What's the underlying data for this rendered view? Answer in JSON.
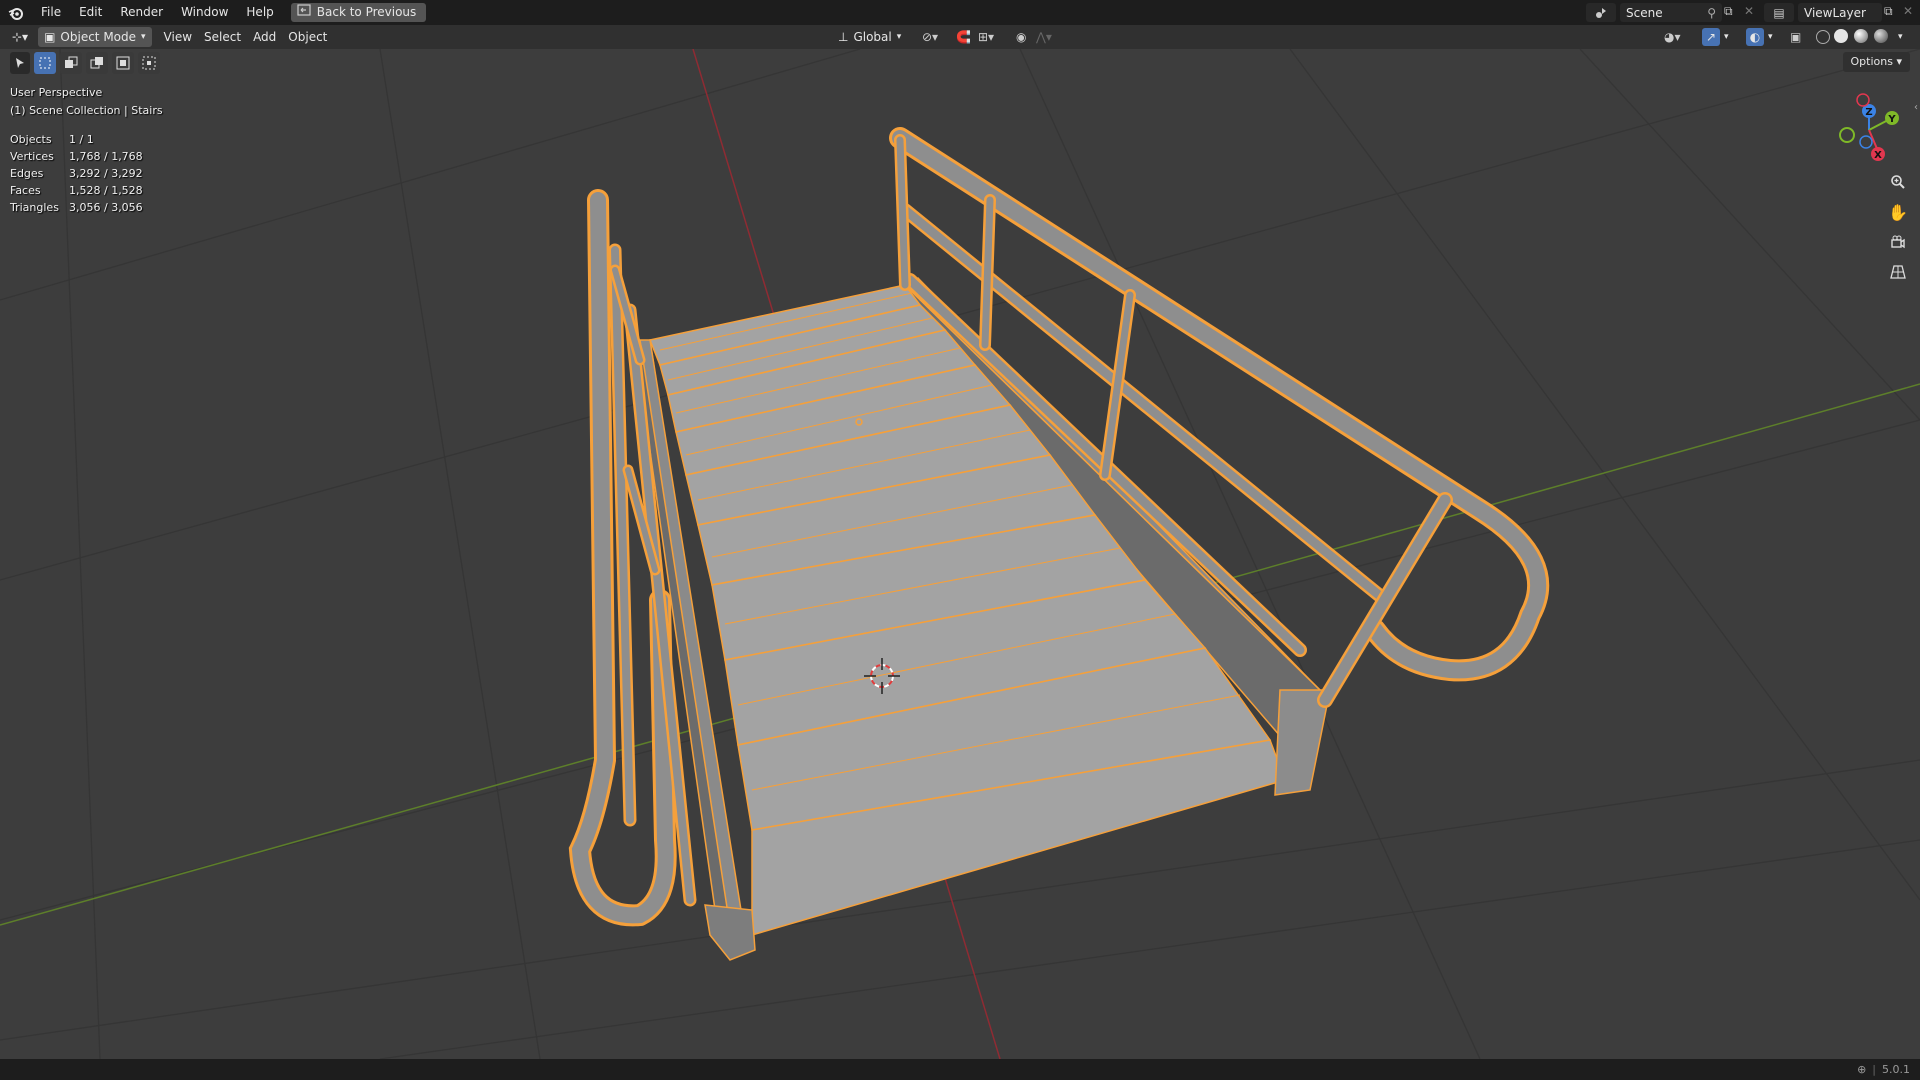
{
  "topbar": {
    "menu": [
      "File",
      "Edit",
      "Render",
      "Window",
      "Help"
    ],
    "back_button": "Back to Previous",
    "scene": "Scene",
    "view_layer": "ViewLayer"
  },
  "header": {
    "mode": "Object Mode",
    "menu": [
      "View",
      "Select",
      "Add",
      "Object"
    ],
    "orientation": "Global",
    "options": "Options"
  },
  "viewport": {
    "perspective": "User Perspective",
    "collection": "(1) Scene Collection | Stairs",
    "stats": [
      {
        "label": "Objects",
        "value": "1 / 1"
      },
      {
        "label": "Vertices",
        "value": "1,768 / 1,768"
      },
      {
        "label": "Edges",
        "value": "3,292 / 3,292"
      },
      {
        "label": "Faces",
        "value": "1,528 / 1,528"
      },
      {
        "label": "Triangles",
        "value": "3,056 / 3,056"
      }
    ],
    "gizmo": {
      "x": "X",
      "y": "Y",
      "z": "Z"
    }
  },
  "colors": {
    "selection": "#f5a03b",
    "mesh": "#9a9a9a",
    "x_axis": "#e2374f",
    "y_axis": "#7fb928",
    "z_axis": "#3b83e6"
  },
  "status": {
    "version": "5.0.1"
  }
}
